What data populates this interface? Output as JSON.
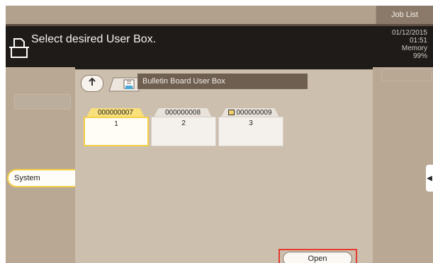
{
  "topbar": {
    "job_list_label": "Job List"
  },
  "header": {
    "title": "Select desired User Box.",
    "date": "01/12/2015",
    "time": "01:51",
    "memory_label": "Memory",
    "memory_value": "99%"
  },
  "left": {
    "system_label": "System"
  },
  "breadcrumb": {
    "label": "Bulletin Board User Box"
  },
  "boxes": [
    {
      "number": "000000007",
      "label": "1",
      "selected": true,
      "locked": false
    },
    {
      "number": "000000008",
      "label": "2",
      "selected": false,
      "locked": false
    },
    {
      "number": "000000009",
      "label": "3",
      "selected": false,
      "locked": true
    }
  ],
  "actions": {
    "open_label": "Open"
  },
  "icons": {
    "header": "user-box-icon",
    "up": "up-arrow-icon",
    "folder": "bulletin-board-icon",
    "lock": "lock-icon",
    "side_tab": "arrow-left-icon"
  },
  "colors": {
    "background": "#b8a894",
    "header": "#1f1b18",
    "panel": "#cdbfae",
    "selected_border": "#f4cf45",
    "open_highlight": "#e53a2e"
  }
}
